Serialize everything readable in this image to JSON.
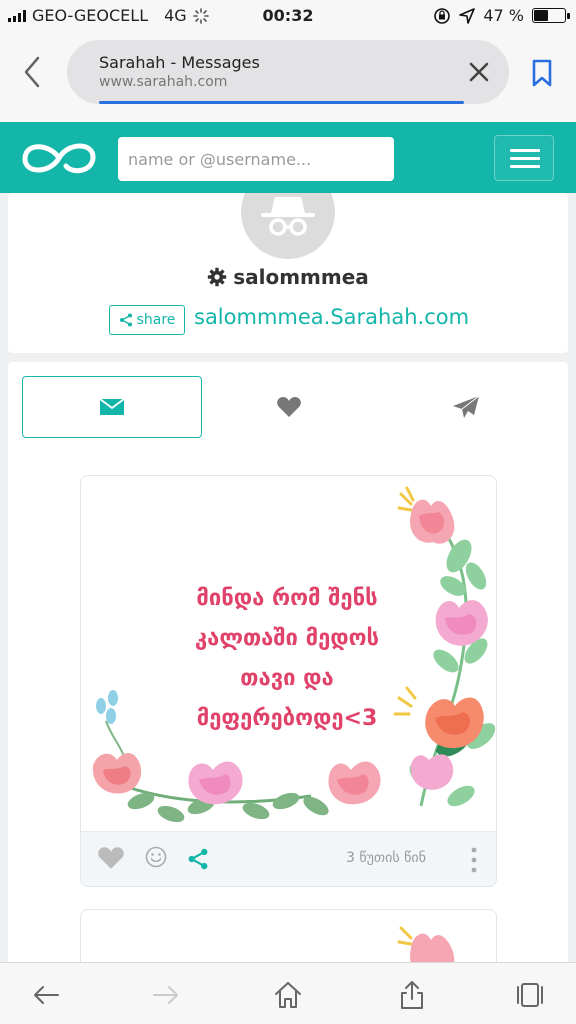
{
  "status_bar": {
    "carrier": "GEO-GEOCELL",
    "network": "4G",
    "time": "00:32",
    "battery_percent": "47 %",
    "battery_level": 0.47
  },
  "browser": {
    "page_title": "Sarahah - Messages",
    "url": "www.sarahah.com",
    "load_progress": 0.9
  },
  "header": {
    "search_placeholder": "name or @username..."
  },
  "profile": {
    "username": "salommmea",
    "share_label": "share",
    "profile_link": "salommmea.Sarahah.com"
  },
  "tabs": [
    {
      "icon": "envelope-icon",
      "active": true
    },
    {
      "icon": "heart-icon",
      "active": false
    },
    {
      "icon": "paper-plane-icon",
      "active": false
    }
  ],
  "messages": [
    {
      "text_lines": [
        "მინდა რომ შენს",
        "კალთაში მედოს",
        "თავი და",
        "მეფერებოდე<3"
      ],
      "time": "3 წუთის წინ"
    }
  ],
  "colors": {
    "accent": "#13b6a9",
    "message_text": "#e0426a",
    "link_blue": "#2a6ee0"
  }
}
